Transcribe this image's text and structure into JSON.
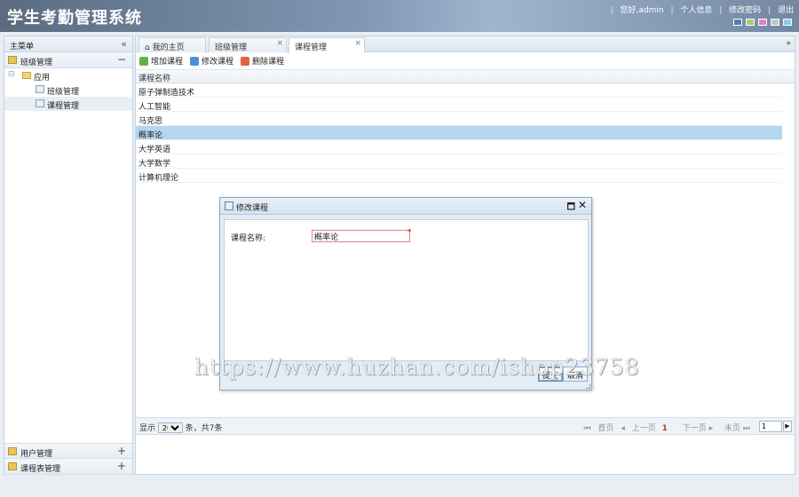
{
  "app": {
    "title": "学生考勤管理系统"
  },
  "topnav": {
    "greeting": "您好,admin",
    "profile": "个人信息",
    "change_password": "修改密码",
    "logout": "退出",
    "sep": "|"
  },
  "themes": [
    "#4f7fb3",
    "#9fd36a",
    "#e07fd1",
    "#c2c6cc",
    "#8fc9ef"
  ],
  "sidebar": {
    "title": "主菜单",
    "collapse_icon": "«",
    "sections": [
      {
        "label": "班级管理",
        "toggle": "−"
      },
      {
        "label": "用户管理",
        "toggle": "+"
      },
      {
        "label": "课程表管理",
        "toggle": "+"
      }
    ],
    "tree": {
      "expander": "⊟",
      "root": "应用",
      "items": [
        "班级管理",
        "课程管理"
      ]
    }
  },
  "tabs": [
    {
      "label": "我的主页"
    },
    {
      "label": "班级管理",
      "close": "×"
    },
    {
      "label": "课程管理",
      "close": "×"
    }
  ],
  "tabs_dropdown": "»",
  "toolbar": {
    "add": "增加课程",
    "edit": "修改课程",
    "delete": "删除课程"
  },
  "grid": {
    "column": "课程名称",
    "rows": [
      "原子弹制造技术",
      "人工智能",
      "马克思",
      "概率论",
      "大学英语",
      "大学数学",
      "计算机理论"
    ],
    "selected_index": 3
  },
  "pager": {
    "show_label": "显示",
    "page_size": "20",
    "total_text": "条，共7条",
    "first": "首页",
    "prev": "上一页",
    "current_page": "1",
    "next": "下一页",
    "last": "末页",
    "page_input": "1",
    "go": "▶"
  },
  "dialog": {
    "title": "修改课程",
    "max_icon": "🗖",
    "close_icon": "✕",
    "field_label": "课程名称:",
    "field_value": "概率论",
    "required_mark": "*",
    "submit": "提交",
    "cancel": "取消"
  },
  "watermark": "https://www.huzhan.com/ishop23758"
}
